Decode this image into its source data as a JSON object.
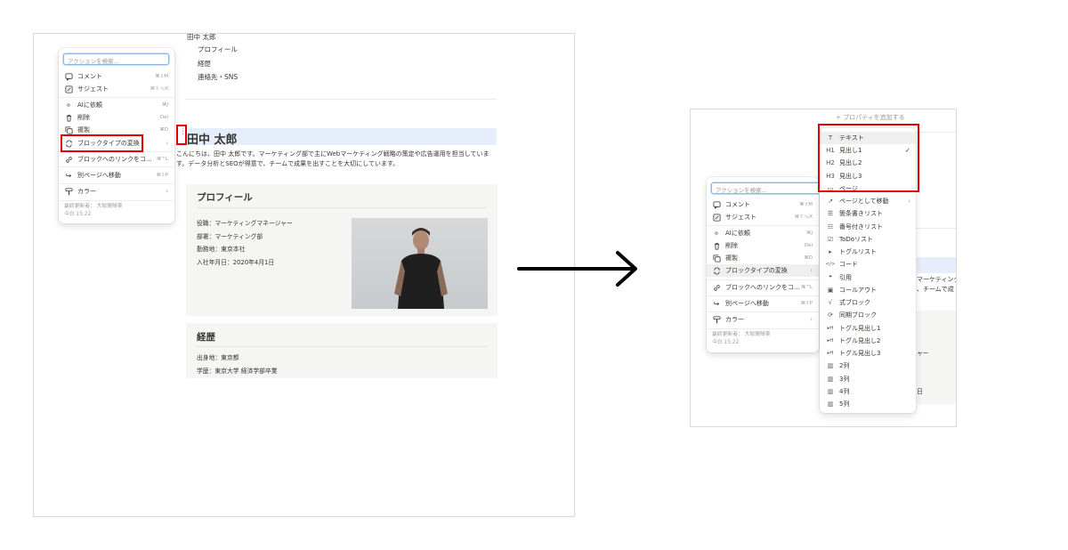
{
  "left": {
    "toc": {
      "parent": "田中 太郎",
      "items": [
        "プロフィール",
        "経歴",
        "連絡先・SNS"
      ]
    },
    "heading": "田中 太郎",
    "intro": [
      "こんにちは、田中 太郎です。マーケティング部で主にWebマーケティング戦略の策定や広告運用を担当していま",
      "す。データ分析とSEOが得意で、チームで成果を出すことを大切にしています。"
    ],
    "profile": {
      "title": "プロフィール",
      "lines": [
        "役職：マーケティングマネージャー",
        "部署：マーケティング部",
        "勤務地：東京本社",
        "入社年月日：2020年4月1日"
      ]
    },
    "career": {
      "title": "経歴",
      "lines": [
        "出身地：東京都",
        "学歴：東京大学 経済学部卒業"
      ]
    }
  },
  "action_menu": {
    "search_placeholder": "アクションを検索...",
    "items": [
      {
        "label": "コメント",
        "shortcut": "⌘⇧M",
        "icon": "comment-icon"
      },
      {
        "label": "サジェスト",
        "shortcut": "⌘⇧⌥X",
        "icon": "suggest-icon"
      },
      {
        "label": "AIに依頼",
        "shortcut": "⌘J",
        "icon": "ai-icon"
      },
      {
        "label": "削除",
        "shortcut": "Del",
        "icon": "trash-icon"
      },
      {
        "label": "複製",
        "shortcut": "⌘D",
        "icon": "duplicate-icon"
      },
      {
        "label": "ブロックタイプの変換",
        "shortcut": "›",
        "icon": "turn-into-icon"
      },
      {
        "label": "ブロックへのリンクをコ...",
        "shortcut": "⌘^L",
        "icon": "link-icon"
      },
      {
        "label": "別ページへ移動",
        "shortcut": "⌘⇧P",
        "icon": "move-icon"
      },
      {
        "label": "カラー",
        "shortcut": "›",
        "icon": "paint-icon"
      }
    ],
    "footer": [
      "最終更新者： 大坂間琴美",
      "今日 15:22"
    ]
  },
  "right": {
    "add_property": "+ プロパティを追加する",
    "bg_text": [
      "マーケティング",
      "、チームで成",
      "ャー",
      "日"
    ],
    "turn_into_menu": [
      {
        "label": "テキスト",
        "icon": "T"
      },
      {
        "label": "見出し1",
        "icon": "H1",
        "checked": "✓"
      },
      {
        "label": "見出し2",
        "icon": "H2"
      },
      {
        "label": "見出し3",
        "icon": "H3"
      },
      {
        "label": "ページ",
        "icon": "▭"
      },
      {
        "label": "ページとして移動",
        "icon": "↗",
        "chevron": "›"
      },
      {
        "label": "箇条書きリスト",
        "icon": "☰"
      },
      {
        "label": "番号付きリスト",
        "icon": "☷"
      },
      {
        "label": "ToDoリスト",
        "icon": "☑"
      },
      {
        "label": "トグルリスト",
        "icon": "▸"
      },
      {
        "label": "コード",
        "icon": "</>"
      },
      {
        "label": "引用",
        "icon": "❝"
      },
      {
        "label": "コールアウト",
        "icon": "▣"
      },
      {
        "label": "式ブロック",
        "icon": "√"
      },
      {
        "label": "同期ブロック",
        "icon": "⟳"
      },
      {
        "label": "トグル見出し1",
        "icon": "▸H"
      },
      {
        "label": "トグル見出し2",
        "icon": "▸H"
      },
      {
        "label": "トグル見出し3",
        "icon": "▸H"
      },
      {
        "label": "2列",
        "icon": "▥"
      },
      {
        "label": "3列",
        "icon": "▥"
      },
      {
        "label": "4列",
        "icon": "▥"
      },
      {
        "label": "5列",
        "icon": "▥"
      }
    ]
  }
}
